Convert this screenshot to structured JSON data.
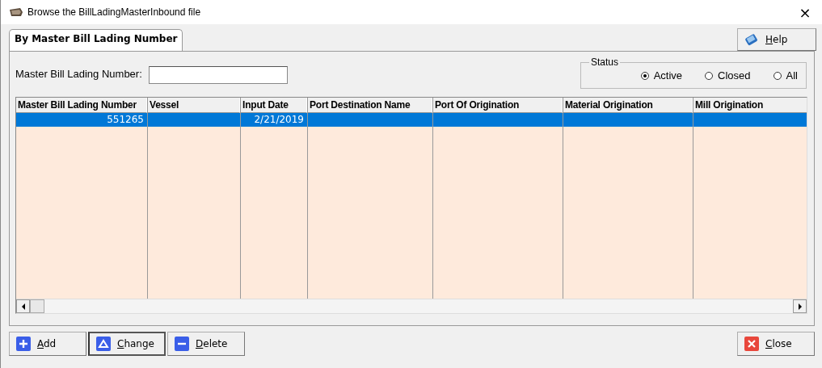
{
  "window": {
    "title": "Browse the BillLadingMasterInbound file",
    "close": "×"
  },
  "tabs": [
    {
      "label": "By Master Bill Lading Number",
      "selected": true
    }
  ],
  "help_button": "Help",
  "search": {
    "label": "Master Bill Lading Number:"
  },
  "status": {
    "title": "Status",
    "options": [
      {
        "label": "Active",
        "selected": true
      },
      {
        "label": "Closed",
        "selected": false
      },
      {
        "label": "All",
        "selected": false
      }
    ]
  },
  "table": {
    "columns": [
      "Master Bill Lading Number",
      "Vessel",
      "Input Date",
      "Port Destination Name",
      "Port Of Origination",
      "Material Origination",
      "Mill Origination"
    ],
    "rows": [
      {
        "selected": true,
        "cells": [
          "551265",
          null,
          "2/21/2019",
          null,
          null,
          null,
          null
        ]
      }
    ]
  },
  "buttons": [
    {
      "label": "Add",
      "kind": "add"
    },
    {
      "label": "Change",
      "kind": "change"
    },
    {
      "label": "Delete",
      "kind": "delete"
    }
  ],
  "close_button": "Close"
}
